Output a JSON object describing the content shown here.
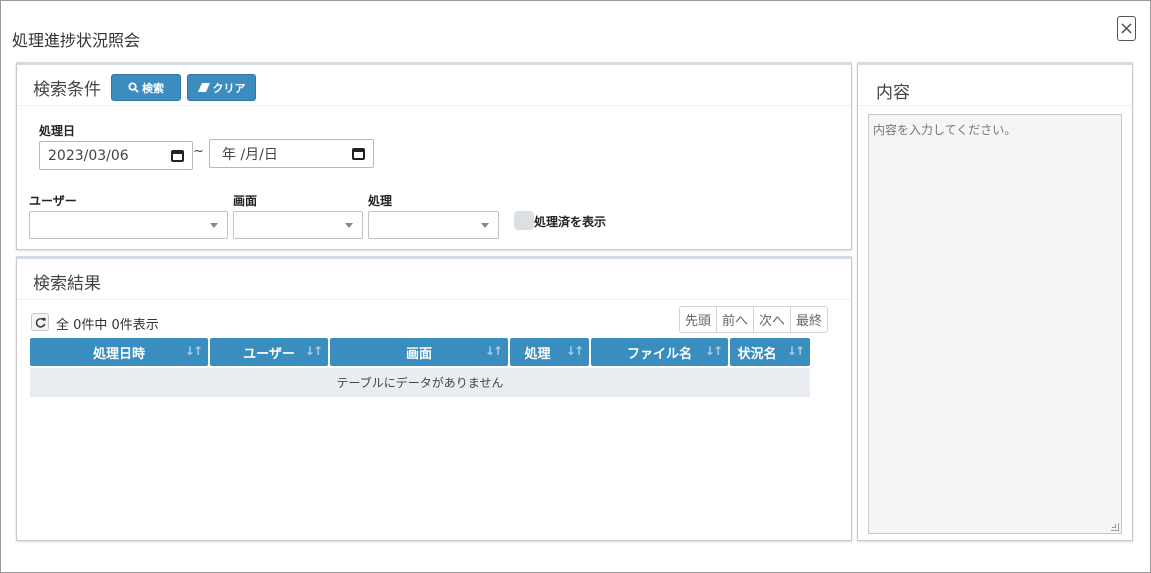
{
  "dialog": {
    "title": "処理進捗状況照会",
    "close_glyph": "×"
  },
  "search": {
    "title": "検索条件",
    "search_button": "検索",
    "clear_button": "クリア",
    "date_label": "処理日",
    "date_from": "2023/03/06",
    "date_to_placeholder": "年 /月/日",
    "range_separator": "~",
    "user_label": "ユーザー",
    "screen_label": "画面",
    "process_label": "処理",
    "user_value": "",
    "screen_value": "",
    "process_value": "",
    "show_processed_label": "処理済を表示",
    "show_processed_on": false
  },
  "results": {
    "title": "検索結果",
    "count_text": "全 0件中 0件表示",
    "pager": [
      "先頭",
      "前へ",
      "次へ",
      "最終"
    ],
    "columns": [
      "処理日時",
      "ユーザー",
      "画面",
      "処理",
      "ファイル名",
      "状況名"
    ],
    "empty_message": "テーブルにデータがありません",
    "sort_glyph": "↓↑"
  },
  "content": {
    "title": "内容",
    "placeholder": "内容を入力してください。"
  },
  "colors": {
    "primary": "#3d8cc0",
    "header": "#3a8dbf",
    "empty_row": "#e9edf1"
  }
}
